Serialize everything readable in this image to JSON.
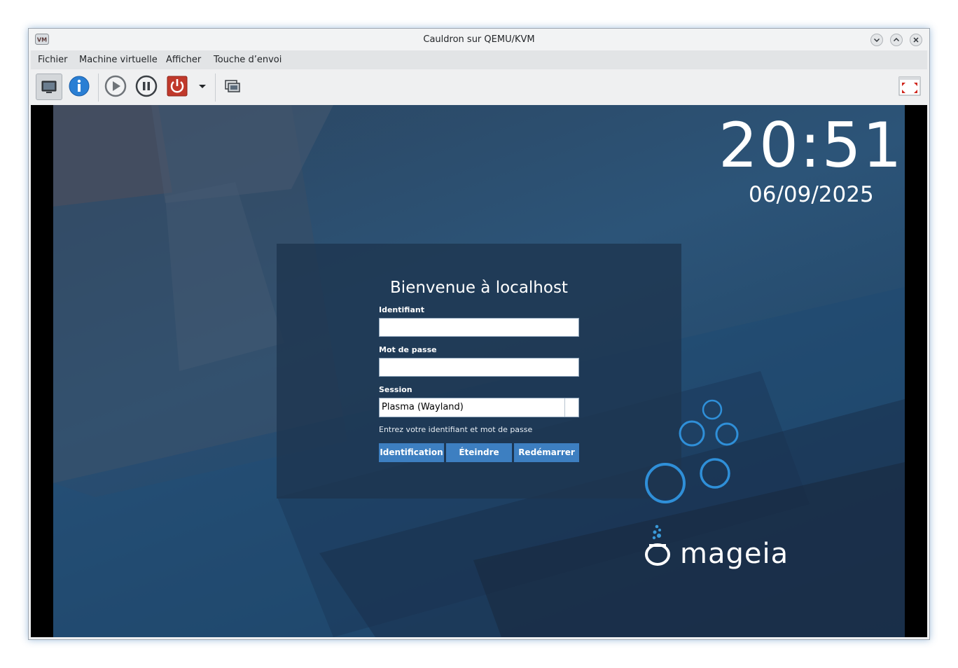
{
  "window": {
    "title": "Cauldron sur QEMU/KVM",
    "app_icon": "virt-manager-icon",
    "controls": [
      "minimize-icon",
      "maximize-icon",
      "close-icon"
    ]
  },
  "menubar": {
    "items": [
      {
        "label": "Fichier"
      },
      {
        "label": "Machine virtuelle"
      },
      {
        "label": "Afficher"
      },
      {
        "label": "Touche d’envoi"
      }
    ]
  },
  "toolbar": {
    "buttons": [
      "console-view-icon",
      "details-info-icon",
      "run-play-icon",
      "pause-icon",
      "power-off-icon",
      "dropdown-arrow-icon",
      "snapshots-icon",
      "fullscreen-icon"
    ]
  },
  "desktop": {
    "clock": "20:51",
    "date": "06/09/2025",
    "login": {
      "welcome": "Bienvenue à localhost",
      "username_label": "Identifiant",
      "username_value": "",
      "password_label": "Mot de passe",
      "password_value": "",
      "session_label": "Session",
      "session_value": "Plasma (Wayland)",
      "hint": "Entrez votre identifiant et mot de passe",
      "buttons": {
        "login": "Identification",
        "shutdown": "Éteindre",
        "reboot": "Redémarrer"
      }
    },
    "logo_text": "mageia"
  },
  "colors": {
    "accent_button": "#3d7fc1",
    "logo_bubbles": "#3a9ad9",
    "power_button": "#c0392b"
  }
}
